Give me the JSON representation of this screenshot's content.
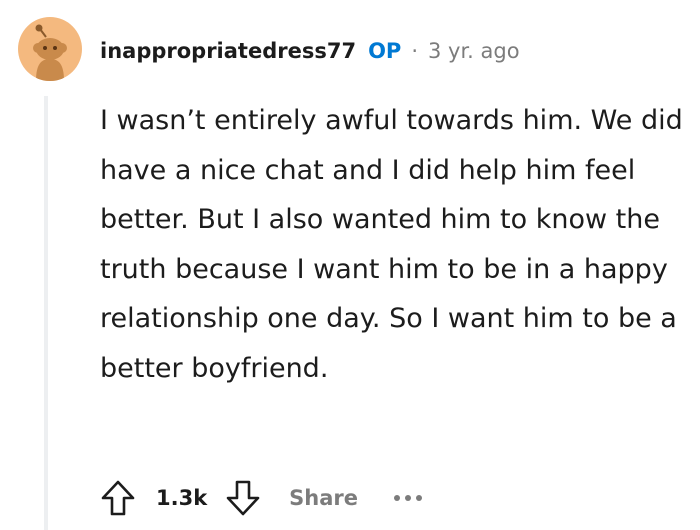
{
  "comment": {
    "author": "inappropriatedress77",
    "op_badge": "OP",
    "separator": "·",
    "timestamp": "3 yr. ago",
    "body": "I wasn’t entirely awful towards him. We did have a nice chat and I did help him feel better. But I also wanted him to know the truth because I want him to be in a happy relationship one day. So I want him to be a better boyfriend."
  },
  "actions": {
    "score": "1.3k",
    "share_label": "Share",
    "upvote_icon": "upvote-arrow-icon",
    "downvote_icon": "downvote-arrow-icon",
    "more_icon": "more-options-icon"
  },
  "colors": {
    "avatar_bg": "#f4b97f",
    "op_accent": "#0079d3",
    "muted": "#7c7c7c",
    "thread_line": "#edeff1"
  }
}
